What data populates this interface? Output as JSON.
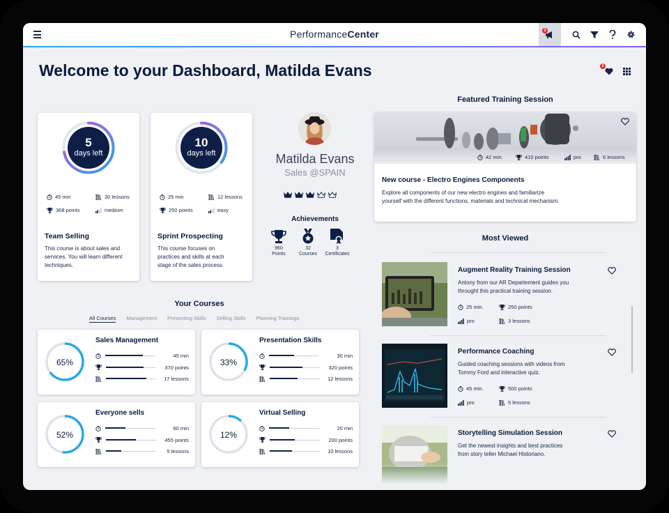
{
  "app": {
    "brand_regular": "Performance",
    "brand_bold": "Center"
  },
  "topbar": {
    "menu_icon": "hamburger-icon",
    "notification_count": "3",
    "icons": [
      "megaphone-icon",
      "search-icon",
      "filter-icon",
      "help-icon",
      "gear-icon"
    ]
  },
  "header": {
    "title": "Welcome to your Dashboard, Matilda Evans",
    "favorites_count": "2"
  },
  "top_courses": [
    {
      "ring_num": "5",
      "ring_label": "days left",
      "progress": 0.72,
      "duration": "45 min",
      "lessons": "30 lessons",
      "points": "368 points",
      "level": "medium",
      "title": "Team Selling",
      "desc": [
        "This course is about sales and",
        "services. You will learn different",
        "techniques."
      ]
    },
    {
      "ring_num": "10",
      "ring_label": "days left",
      "progress": 0.35,
      "duration": "25 min",
      "lessons": "12 lessons",
      "points": "250 points",
      "level": "easy",
      "title": "Sprint Prospecting",
      "desc": [
        "This course focuses on",
        "practices and skills at each",
        "stage of the sales process."
      ]
    }
  ],
  "profile": {
    "name": "Matilda Evans",
    "subtitle": "Sales @SPAIN",
    "rank_filled": 3,
    "achievements_title": "Achievements",
    "achievements": [
      {
        "icon": "trophy-icon",
        "value": "960",
        "label": "Points"
      },
      {
        "icon": "medal-icon",
        "value": "32",
        "label": "Courses"
      },
      {
        "icon": "certificate-icon",
        "value": "3",
        "label": "Certificates"
      }
    ]
  },
  "your_courses": {
    "title": "Your Courses",
    "tabs": [
      "All Courses",
      "Management",
      "Presenting Skills",
      "Selling Skills",
      "Planning Trainings"
    ],
    "items": [
      {
        "title": "Sales Management",
        "percent": "65%",
        "progress": 0.65,
        "minutes": "45 min",
        "points": "370 points",
        "lessons": "17 lessons",
        "fills": [
          0.75,
          0.75,
          0.8
        ]
      },
      {
        "title": "Presentation Skills",
        "percent": "33%",
        "progress": 0.33,
        "minutes": "30 min",
        "points": "320 points",
        "lessons": "12 lessons",
        "fills": [
          0.5,
          0.65,
          0.55
        ]
      },
      {
        "title": "Everyone sells",
        "percent": "52%",
        "progress": 0.52,
        "minutes": "60 min",
        "points": "455 points",
        "lessons": "5 lessons",
        "fills": [
          0.4,
          0.6,
          0.3
        ]
      },
      {
        "title": "Virtual Selling",
        "percent": "12%",
        "progress": 0.12,
        "minutes": "20 min",
        "points": "200 points",
        "lessons": "10 lessons",
        "fills": [
          0.4,
          0.5,
          0.45
        ]
      }
    ]
  },
  "featured": {
    "title": "Featured Training Session",
    "duration": "42 min.",
    "points": "410 points",
    "level": "pro",
    "lessons": "6 lessons",
    "course_title": "New course - Electro Engines Components",
    "desc": [
      "Explore all components of our new electro engines and familiarize",
      "yourself with the different functions, materials and technical mechanism."
    ]
  },
  "most_viewed": {
    "title": "Most Viewed",
    "items": [
      {
        "title": "Augment Reality Training Session",
        "desc": [
          "Antony from our AR Departement guides you",
          "throught this practical training session."
        ],
        "duration": "25 min.",
        "points": "250 points",
        "level": "pro",
        "lessons": "3 lessons"
      },
      {
        "title": "Performance Coaching",
        "desc": [
          "Guided coaching sessions with videos from",
          "Tommy Ford and interactive quiz."
        ],
        "duration": "45 min.",
        "points": "500 points",
        "level": "pro",
        "lessons": "5 lessons"
      },
      {
        "title": "Storytelling Simulation Session",
        "desc": [
          "Get the newest insights and best practices",
          "from story teller Michael Historiano."
        ]
      }
    ]
  }
}
